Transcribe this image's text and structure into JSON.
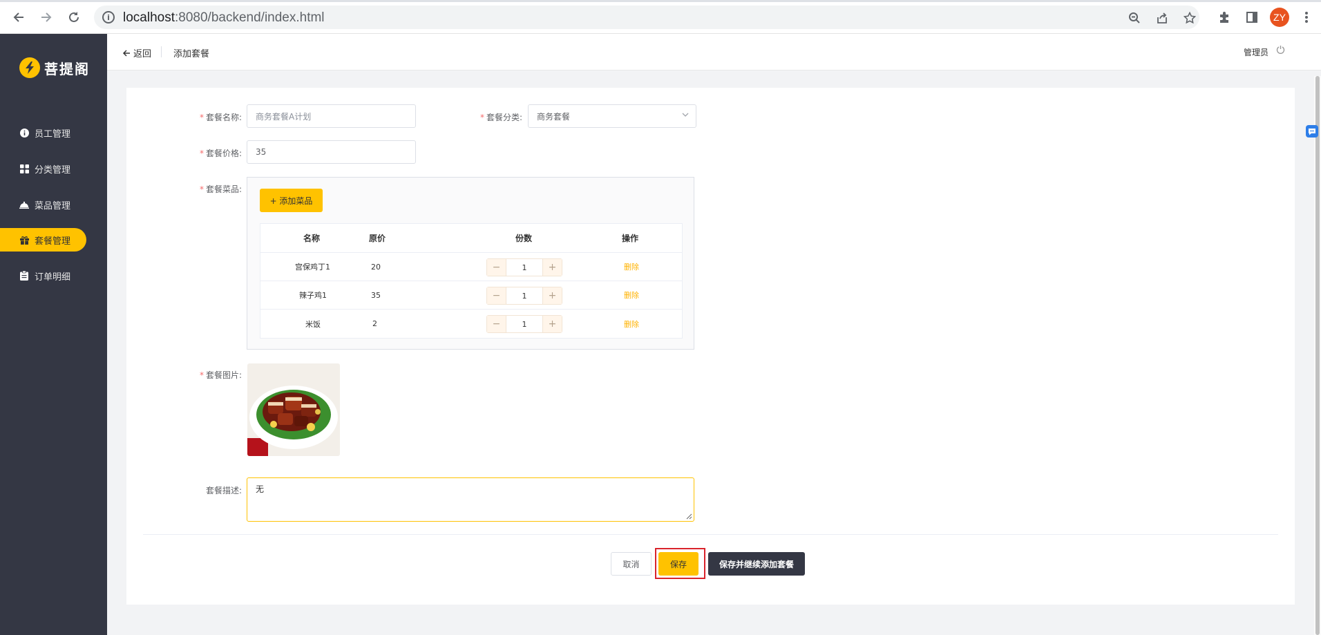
{
  "browser": {
    "url_host": "localhost",
    "url_path": ":8080/backend/index.html",
    "profile_initials": "ZY",
    "icons": [
      "back-arrow-icon",
      "forward-arrow-icon",
      "reload-icon",
      "site-info-icon",
      "zoom-icon",
      "share-icon",
      "bookmark-star-icon",
      "extensions-icon",
      "side-panel-icon",
      "more-icon"
    ]
  },
  "sidebar": {
    "logo_text": "菩提阁",
    "items": [
      {
        "label": "员工管理",
        "icon": "info-circle-icon",
        "active": false
      },
      {
        "label": "分类管理",
        "icon": "grid-icon",
        "active": false
      },
      {
        "label": "菜品管理",
        "icon": "dish-cover-icon",
        "active": false
      },
      {
        "label": "套餐管理",
        "icon": "gift-icon",
        "active": true
      },
      {
        "label": "订单明细",
        "icon": "clipboard-icon",
        "active": false
      }
    ]
  },
  "header": {
    "back_label": "返回",
    "page_title": "添加套餐",
    "user_label": "管理员"
  },
  "form": {
    "name": {
      "label": "套餐名称:",
      "placeholder": "商务套餐A计划"
    },
    "category": {
      "label": "套餐分类:",
      "value": "商务套餐"
    },
    "price": {
      "label": "套餐价格:",
      "value": "35"
    },
    "dishes": {
      "label": "套餐菜品:",
      "add_button": "+ 添加菜品",
      "columns": [
        "名称",
        "原价",
        "份数",
        "操作"
      ],
      "rows": [
        {
          "name": "宫保鸡丁1",
          "price": "20",
          "qty": "1",
          "action": "删除"
        },
        {
          "name": "辣子鸡1",
          "price": "35",
          "qty": "1",
          "action": "删除"
        },
        {
          "name": "米饭",
          "price": "2",
          "qty": "1",
          "action": "删除"
        }
      ]
    },
    "image": {
      "label": "套餐图片:"
    },
    "description": {
      "label": "套餐描述:",
      "value": "无"
    }
  },
  "actions": {
    "cancel": "取消",
    "save": "保存",
    "save_and_continue": "保存并继续添加套餐"
  },
  "colors": {
    "accent": "#ffc200",
    "sidebar_bg": "#343744",
    "required": "#f56c6c",
    "delete_link": "#ffb302",
    "highlight_border": "#d9232b"
  }
}
